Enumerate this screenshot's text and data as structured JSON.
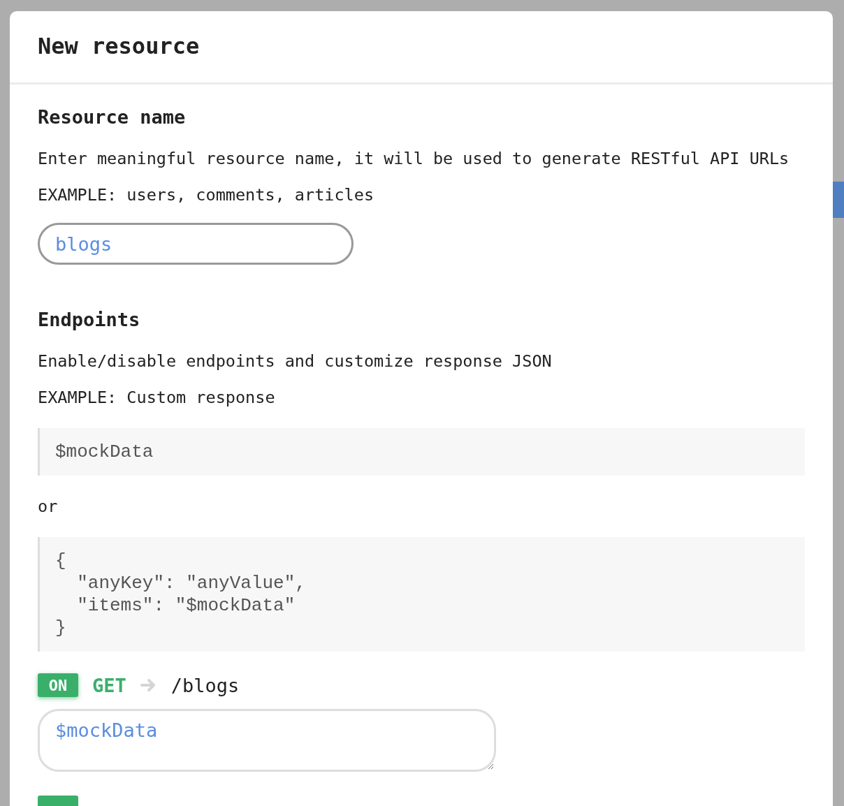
{
  "modal": {
    "title": "New resource"
  },
  "resource_section": {
    "heading": "Resource name",
    "description": "Enter meaningful resource name, it will be used to generate RESTful API URLs",
    "example": "EXAMPLE: users, comments, articles",
    "name_field": {
      "value": "blogs"
    }
  },
  "endpoints_section": {
    "heading": "Endpoints",
    "description": "Enable/disable endpoints and customize response JSON",
    "example": "EXAMPLE: Custom response",
    "code_examples": [
      [
        "$mockData"
      ],
      [
        "{",
        "  \"anyKey\": \"anyValue\",",
        "  \"items\": \"$mockData\"",
        "}"
      ]
    ],
    "separator": "or",
    "endpoints": [
      {
        "on": true,
        "toggle_label": "ON",
        "method": "GET",
        "path": "/blogs",
        "response": "$mockData"
      }
    ]
  }
}
